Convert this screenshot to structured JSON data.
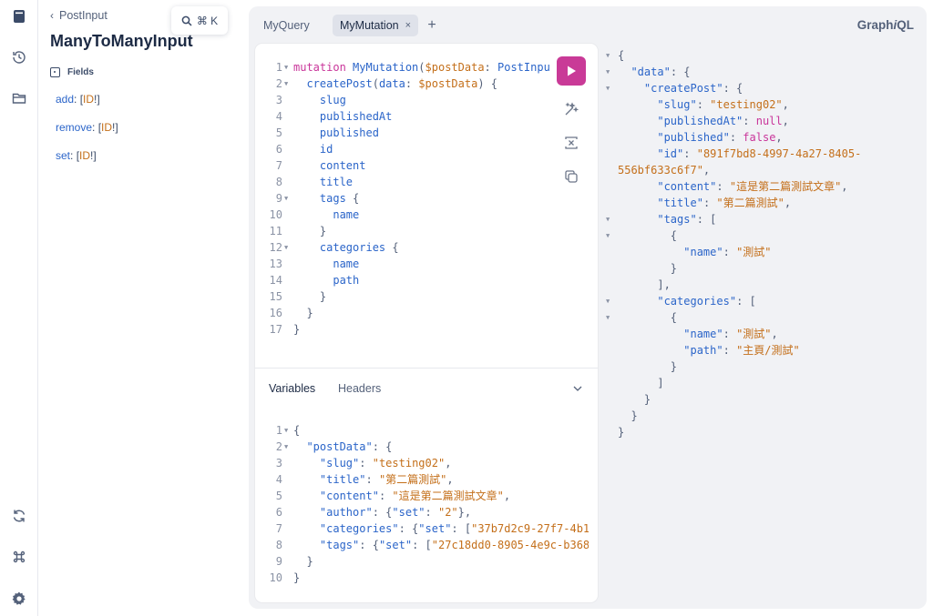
{
  "docs": {
    "back_label": "PostInput",
    "search_shortcut": "⌘ K",
    "type_title": "ManyToManyInput",
    "fields_label": "Fields",
    "fields": [
      {
        "name": "add",
        "open": "[",
        "type": "ID",
        "bang": "!",
        "close": "]"
      },
      {
        "name": "remove",
        "open": "[",
        "type": "ID",
        "bang": "!",
        "close": "]"
      },
      {
        "name": "set",
        "open": "[",
        "type": "ID",
        "bang": "!",
        "close": "]"
      }
    ]
  },
  "tabs": [
    {
      "label": "MyQuery",
      "active": false
    },
    {
      "label": "MyMutation",
      "active": true,
      "close": "×"
    }
  ],
  "tab_add": "+",
  "brand": {
    "prefix": "Graph",
    "italic": "i",
    "suffix": "QL"
  },
  "editor": {
    "lines": [
      {
        "n": "1",
        "fold": true,
        "tokens": [
          [
            "k",
            "mutation "
          ],
          [
            "fnm",
            "MyMutation"
          ],
          [
            "pnc",
            "("
          ],
          [
            "var",
            "$postData"
          ],
          [
            "pnc",
            ": "
          ],
          [
            "typ",
            "PostInpu"
          ]
        ]
      },
      {
        "n": "2",
        "fold": true,
        "tokens": [
          [
            "pnc",
            "  "
          ],
          [
            "fld",
            "createPost"
          ],
          [
            "pnc",
            "("
          ],
          [
            "fld",
            "data"
          ],
          [
            "pnc",
            ": "
          ],
          [
            "var",
            "$postData"
          ],
          [
            "pnc",
            ") {"
          ]
        ]
      },
      {
        "n": "3",
        "tokens": [
          [
            "pnc",
            "    "
          ],
          [
            "fld",
            "slug"
          ]
        ]
      },
      {
        "n": "4",
        "tokens": [
          [
            "pnc",
            "    "
          ],
          [
            "fld",
            "publishedAt"
          ]
        ]
      },
      {
        "n": "5",
        "tokens": [
          [
            "pnc",
            "    "
          ],
          [
            "fld",
            "published"
          ]
        ]
      },
      {
        "n": "6",
        "tokens": [
          [
            "pnc",
            "    "
          ],
          [
            "fld",
            "id"
          ]
        ]
      },
      {
        "n": "7",
        "tokens": [
          [
            "pnc",
            "    "
          ],
          [
            "fld",
            "content"
          ]
        ]
      },
      {
        "n": "8",
        "tokens": [
          [
            "pnc",
            "    "
          ],
          [
            "fld",
            "title"
          ]
        ]
      },
      {
        "n": "9",
        "fold": true,
        "tokens": [
          [
            "pnc",
            "    "
          ],
          [
            "fld",
            "tags"
          ],
          [
            "pnc",
            " {"
          ]
        ]
      },
      {
        "n": "10",
        "tokens": [
          [
            "pnc",
            "      "
          ],
          [
            "fld",
            "name"
          ]
        ]
      },
      {
        "n": "11",
        "tokens": [
          [
            "pnc",
            "    }"
          ]
        ]
      },
      {
        "n": "12",
        "fold": true,
        "tokens": [
          [
            "pnc",
            "    "
          ],
          [
            "fld",
            "categories"
          ],
          [
            "pnc",
            " {"
          ]
        ]
      },
      {
        "n": "13",
        "tokens": [
          [
            "pnc",
            "      "
          ],
          [
            "fld",
            "name"
          ]
        ]
      },
      {
        "n": "14",
        "tokens": [
          [
            "pnc",
            "      "
          ],
          [
            "fld",
            "path"
          ]
        ]
      },
      {
        "n": "15",
        "tokens": [
          [
            "pnc",
            "    }"
          ]
        ]
      },
      {
        "n": "16",
        "tokens": [
          [
            "pnc",
            "  }"
          ]
        ]
      },
      {
        "n": "17",
        "tokens": [
          [
            "pnc",
            "}"
          ]
        ]
      }
    ]
  },
  "variables": {
    "tab_variables": "Variables",
    "tab_headers": "Headers",
    "lines": [
      {
        "n": "1",
        "fold": true,
        "tokens": [
          [
            "pnc",
            "{"
          ]
        ]
      },
      {
        "n": "2",
        "fold": true,
        "tokens": [
          [
            "pnc",
            "  "
          ],
          [
            "key",
            "\"postData\""
          ],
          [
            "pnc",
            ": {"
          ]
        ]
      },
      {
        "n": "3",
        "tokens": [
          [
            "pnc",
            "    "
          ],
          [
            "key",
            "\"slug\""
          ],
          [
            "pnc",
            ": "
          ],
          [
            "str",
            "\"testing02\""
          ],
          [
            "pnc",
            ","
          ]
        ]
      },
      {
        "n": "4",
        "tokens": [
          [
            "pnc",
            "    "
          ],
          [
            "key",
            "\"title\""
          ],
          [
            "pnc",
            ": "
          ],
          [
            "str",
            "\"第二篇測試\""
          ],
          [
            "pnc",
            ","
          ]
        ]
      },
      {
        "n": "5",
        "tokens": [
          [
            "pnc",
            "    "
          ],
          [
            "key",
            "\"content\""
          ],
          [
            "pnc",
            ": "
          ],
          [
            "str",
            "\"這是第二篇測試文章\""
          ],
          [
            "pnc",
            ","
          ]
        ]
      },
      {
        "n": "6",
        "tokens": [
          [
            "pnc",
            "    "
          ],
          [
            "key",
            "\"author\""
          ],
          [
            "pnc",
            ": {"
          ],
          [
            "key",
            "\"set\""
          ],
          [
            "pnc",
            ": "
          ],
          [
            "str",
            "\"2\""
          ],
          [
            "pnc",
            "},"
          ]
        ]
      },
      {
        "n": "7",
        "tokens": [
          [
            "pnc",
            "    "
          ],
          [
            "key",
            "\"categories\""
          ],
          [
            "pnc",
            ": {"
          ],
          [
            "key",
            "\"set\""
          ],
          [
            "pnc",
            ": ["
          ],
          [
            "str",
            "\"37b7d2c9-27f7-4b1"
          ]
        ]
      },
      {
        "n": "8",
        "tokens": [
          [
            "pnc",
            "    "
          ],
          [
            "key",
            "\"tags\""
          ],
          [
            "pnc",
            ": {"
          ],
          [
            "key",
            "\"set\""
          ],
          [
            "pnc",
            ": ["
          ],
          [
            "str",
            "\"27c18dd0-8905-4e9c-b368"
          ]
        ]
      },
      {
        "n": "9",
        "tokens": [
          [
            "pnc",
            "  }"
          ]
        ]
      },
      {
        "n": "10",
        "tokens": [
          [
            "pnc",
            "}"
          ]
        ]
      }
    ]
  },
  "result": {
    "lines": [
      {
        "fold": true,
        "tokens": [
          [
            "pnc",
            "{"
          ]
        ]
      },
      {
        "fold": true,
        "tokens": [
          [
            "pnc",
            "  "
          ],
          [
            "key",
            "\"data\""
          ],
          [
            "pnc",
            ": {"
          ]
        ]
      },
      {
        "fold": true,
        "tokens": [
          [
            "pnc",
            "    "
          ],
          [
            "key",
            "\"createPost\""
          ],
          [
            "pnc",
            ": {"
          ]
        ]
      },
      {
        "tokens": [
          [
            "pnc",
            "      "
          ],
          [
            "key",
            "\"slug\""
          ],
          [
            "pnc",
            ": "
          ],
          [
            "str",
            "\"testing02\""
          ],
          [
            "pnc",
            ","
          ]
        ]
      },
      {
        "tokens": [
          [
            "pnc",
            "      "
          ],
          [
            "key",
            "\"publishedAt\""
          ],
          [
            "pnc",
            ": "
          ],
          [
            "kw2",
            "null"
          ],
          [
            "pnc",
            ","
          ]
        ]
      },
      {
        "tokens": [
          [
            "pnc",
            "      "
          ],
          [
            "key",
            "\"published\""
          ],
          [
            "pnc",
            ": "
          ],
          [
            "kw2",
            "false"
          ],
          [
            "pnc",
            ","
          ]
        ]
      },
      {
        "tokens": [
          [
            "pnc",
            "      "
          ],
          [
            "key",
            "\"id\""
          ],
          [
            "pnc",
            ": "
          ],
          [
            "str",
            "\"891f7bd8-4997-4a27-8405-"
          ]
        ]
      },
      {
        "tokens": [
          [
            "str",
            "556bf633c6f7\""
          ],
          [
            "pnc",
            ","
          ]
        ]
      },
      {
        "tokens": [
          [
            "pnc",
            "      "
          ],
          [
            "key",
            "\"content\""
          ],
          [
            "pnc",
            ": "
          ],
          [
            "str",
            "\"這是第二篇測試文章\""
          ],
          [
            "pnc",
            ","
          ]
        ]
      },
      {
        "tokens": [
          [
            "pnc",
            "      "
          ],
          [
            "key",
            "\"title\""
          ],
          [
            "pnc",
            ": "
          ],
          [
            "str",
            "\"第二篇測試\""
          ],
          [
            "pnc",
            ","
          ]
        ]
      },
      {
        "fold": true,
        "tokens": [
          [
            "pnc",
            "      "
          ],
          [
            "key",
            "\"tags\""
          ],
          [
            "pnc",
            ": ["
          ]
        ]
      },
      {
        "fold": true,
        "tokens": [
          [
            "pnc",
            "        {"
          ]
        ]
      },
      {
        "tokens": [
          [
            "pnc",
            "          "
          ],
          [
            "key",
            "\"name\""
          ],
          [
            "pnc",
            ": "
          ],
          [
            "str",
            "\"測試\""
          ]
        ]
      },
      {
        "tokens": [
          [
            "pnc",
            "        }"
          ]
        ]
      },
      {
        "tokens": [
          [
            "pnc",
            "      ],"
          ]
        ]
      },
      {
        "fold": true,
        "tokens": [
          [
            "pnc",
            "      "
          ],
          [
            "key",
            "\"categories\""
          ],
          [
            "pnc",
            ": ["
          ]
        ]
      },
      {
        "fold": true,
        "tokens": [
          [
            "pnc",
            "        {"
          ]
        ]
      },
      {
        "tokens": [
          [
            "pnc",
            "          "
          ],
          [
            "key",
            "\"name\""
          ],
          [
            "pnc",
            ": "
          ],
          [
            "str",
            "\"測試\""
          ],
          [
            "pnc",
            ","
          ]
        ]
      },
      {
        "tokens": [
          [
            "pnc",
            "          "
          ],
          [
            "key",
            "\"path\""
          ],
          [
            "pnc",
            ": "
          ],
          [
            "str",
            "\"主頁/測試\""
          ]
        ]
      },
      {
        "tokens": [
          [
            "pnc",
            "        }"
          ]
        ]
      },
      {
        "tokens": [
          [
            "pnc",
            "      ]"
          ]
        ]
      },
      {
        "tokens": [
          [
            "pnc",
            "    }"
          ]
        ]
      },
      {
        "tokens": [
          [
            "pnc",
            "  }"
          ]
        ]
      },
      {
        "tokens": [
          [
            "pnc",
            "}"
          ]
        ]
      }
    ]
  },
  "colors": {
    "run_button": "#c93a97",
    "accent_blue": "#2b65c9",
    "accent_orange": "#c46f1a"
  },
  "icons": [
    "docs-icon",
    "history-icon",
    "explorer-icon",
    "refetch-icon",
    "shortcut-icon",
    "settings-icon",
    "search-icon",
    "run-icon",
    "prettify-icon",
    "merge-icon",
    "copy-icon",
    "chevron-down-icon"
  ]
}
